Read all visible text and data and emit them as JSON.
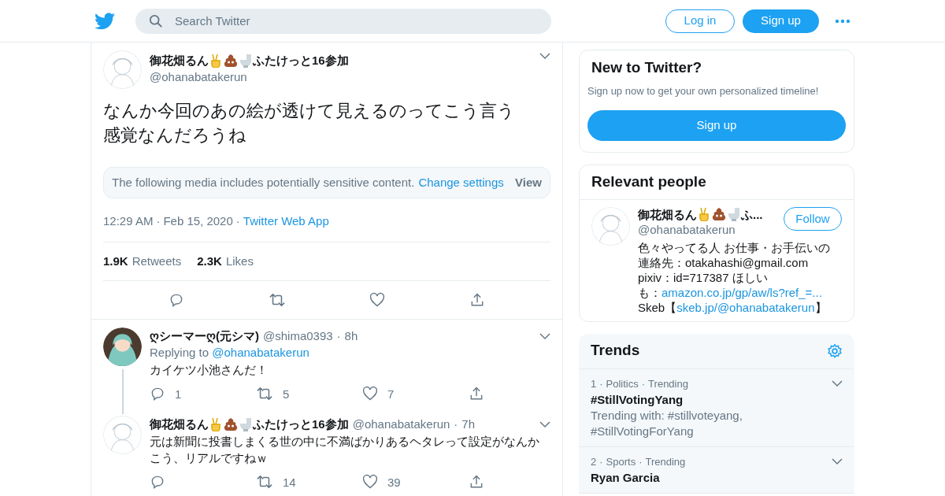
{
  "header": {
    "search_placeholder": "Search Twitter",
    "login": "Log in",
    "signup": "Sign up"
  },
  "tweet": {
    "name": {
      "before": "御花畑るん",
      "after": "ふたけっと16参加"
    },
    "handle": "@ohanabatakerun",
    "lines": [
      "なんか今回のあの絵が透けて見えるのってこう言う",
      "感覚なんだろうね"
    ],
    "sensitive": {
      "text": "The following media includes potentially sensitive content.",
      "link": "Change settings",
      "view": "View"
    },
    "time": "12:29 AM",
    "separators": [
      "·",
      "·"
    ],
    "date": "Feb 15, 2020",
    "source": "Twitter Web App",
    "retweets": "1.9K",
    "retweets_label": "Retweets",
    "likes": "2.3K",
    "likes_label": "Likes"
  },
  "replies": [
    {
      "kind": "photo",
      "name": {
        "plain": "ღシーマーღ(元シマ)"
      },
      "handle": "@shima0393",
      "separator": "·",
      "age": "8h",
      "replying_label": "Replying to",
      "replying_to": "@ohanabatakerun",
      "lines": [
        "カイケツ小池さんだ！"
      ],
      "replies": "1",
      "retweets": "5",
      "likes": "7",
      "thread": true
    },
    {
      "kind": "sketch",
      "name": {
        "before": "御花畑るん",
        "after": "ふたけっと16参加"
      },
      "handle": "@ohanabatakerun",
      "separator": "·",
      "age": "7h",
      "lines": [
        "元は新聞に投書しまくる世の中に不満ばかりあるヘタレって設定がなんか",
        "こう、リアルですねｗ"
      ],
      "retweets": "14",
      "likes": "39",
      "thread": false
    }
  ],
  "new_to_twitter": {
    "title": "New to Twitter?",
    "text": "Sign up now to get your own personalized timeline!",
    "button": "Sign up"
  },
  "relevant_people": {
    "title": "Relevant people",
    "person": {
      "name": {
        "before": "御花畑るん",
        "after": "ふ..."
      },
      "handle": "@ohanabatakerun",
      "follow": "Follow",
      "bio": [
        [
          "色々やってる人 お仕事・お手伝いの"
        ],
        [
          "連絡先：otakahashi@gmail.com"
        ],
        [
          "pixiv：id=717387 ほしい"
        ],
        [
          "も：",
          {
            "link": "amazon.co.jp/gp/aw/ls?ref_=..."
          }
        ],
        [
          "Skeb【",
          {
            "link": "skeb.jp/@ohanabatakerun"
          },
          "】"
        ]
      ]
    }
  },
  "trends": {
    "title": "Trends",
    "items": [
      {
        "rank": "1",
        "separators": [
          "·",
          "·"
        ],
        "category": "Politics",
        "status": "Trending",
        "name": "#StillVotingYang",
        "context": "Trending with: #stillvoteyang, #StillVotingForYang"
      },
      {
        "rank": "2",
        "separators": [
          "·",
          "·"
        ],
        "category": "Sports",
        "status": "Trending",
        "name": "Ryan Garcia"
      }
    ]
  }
}
